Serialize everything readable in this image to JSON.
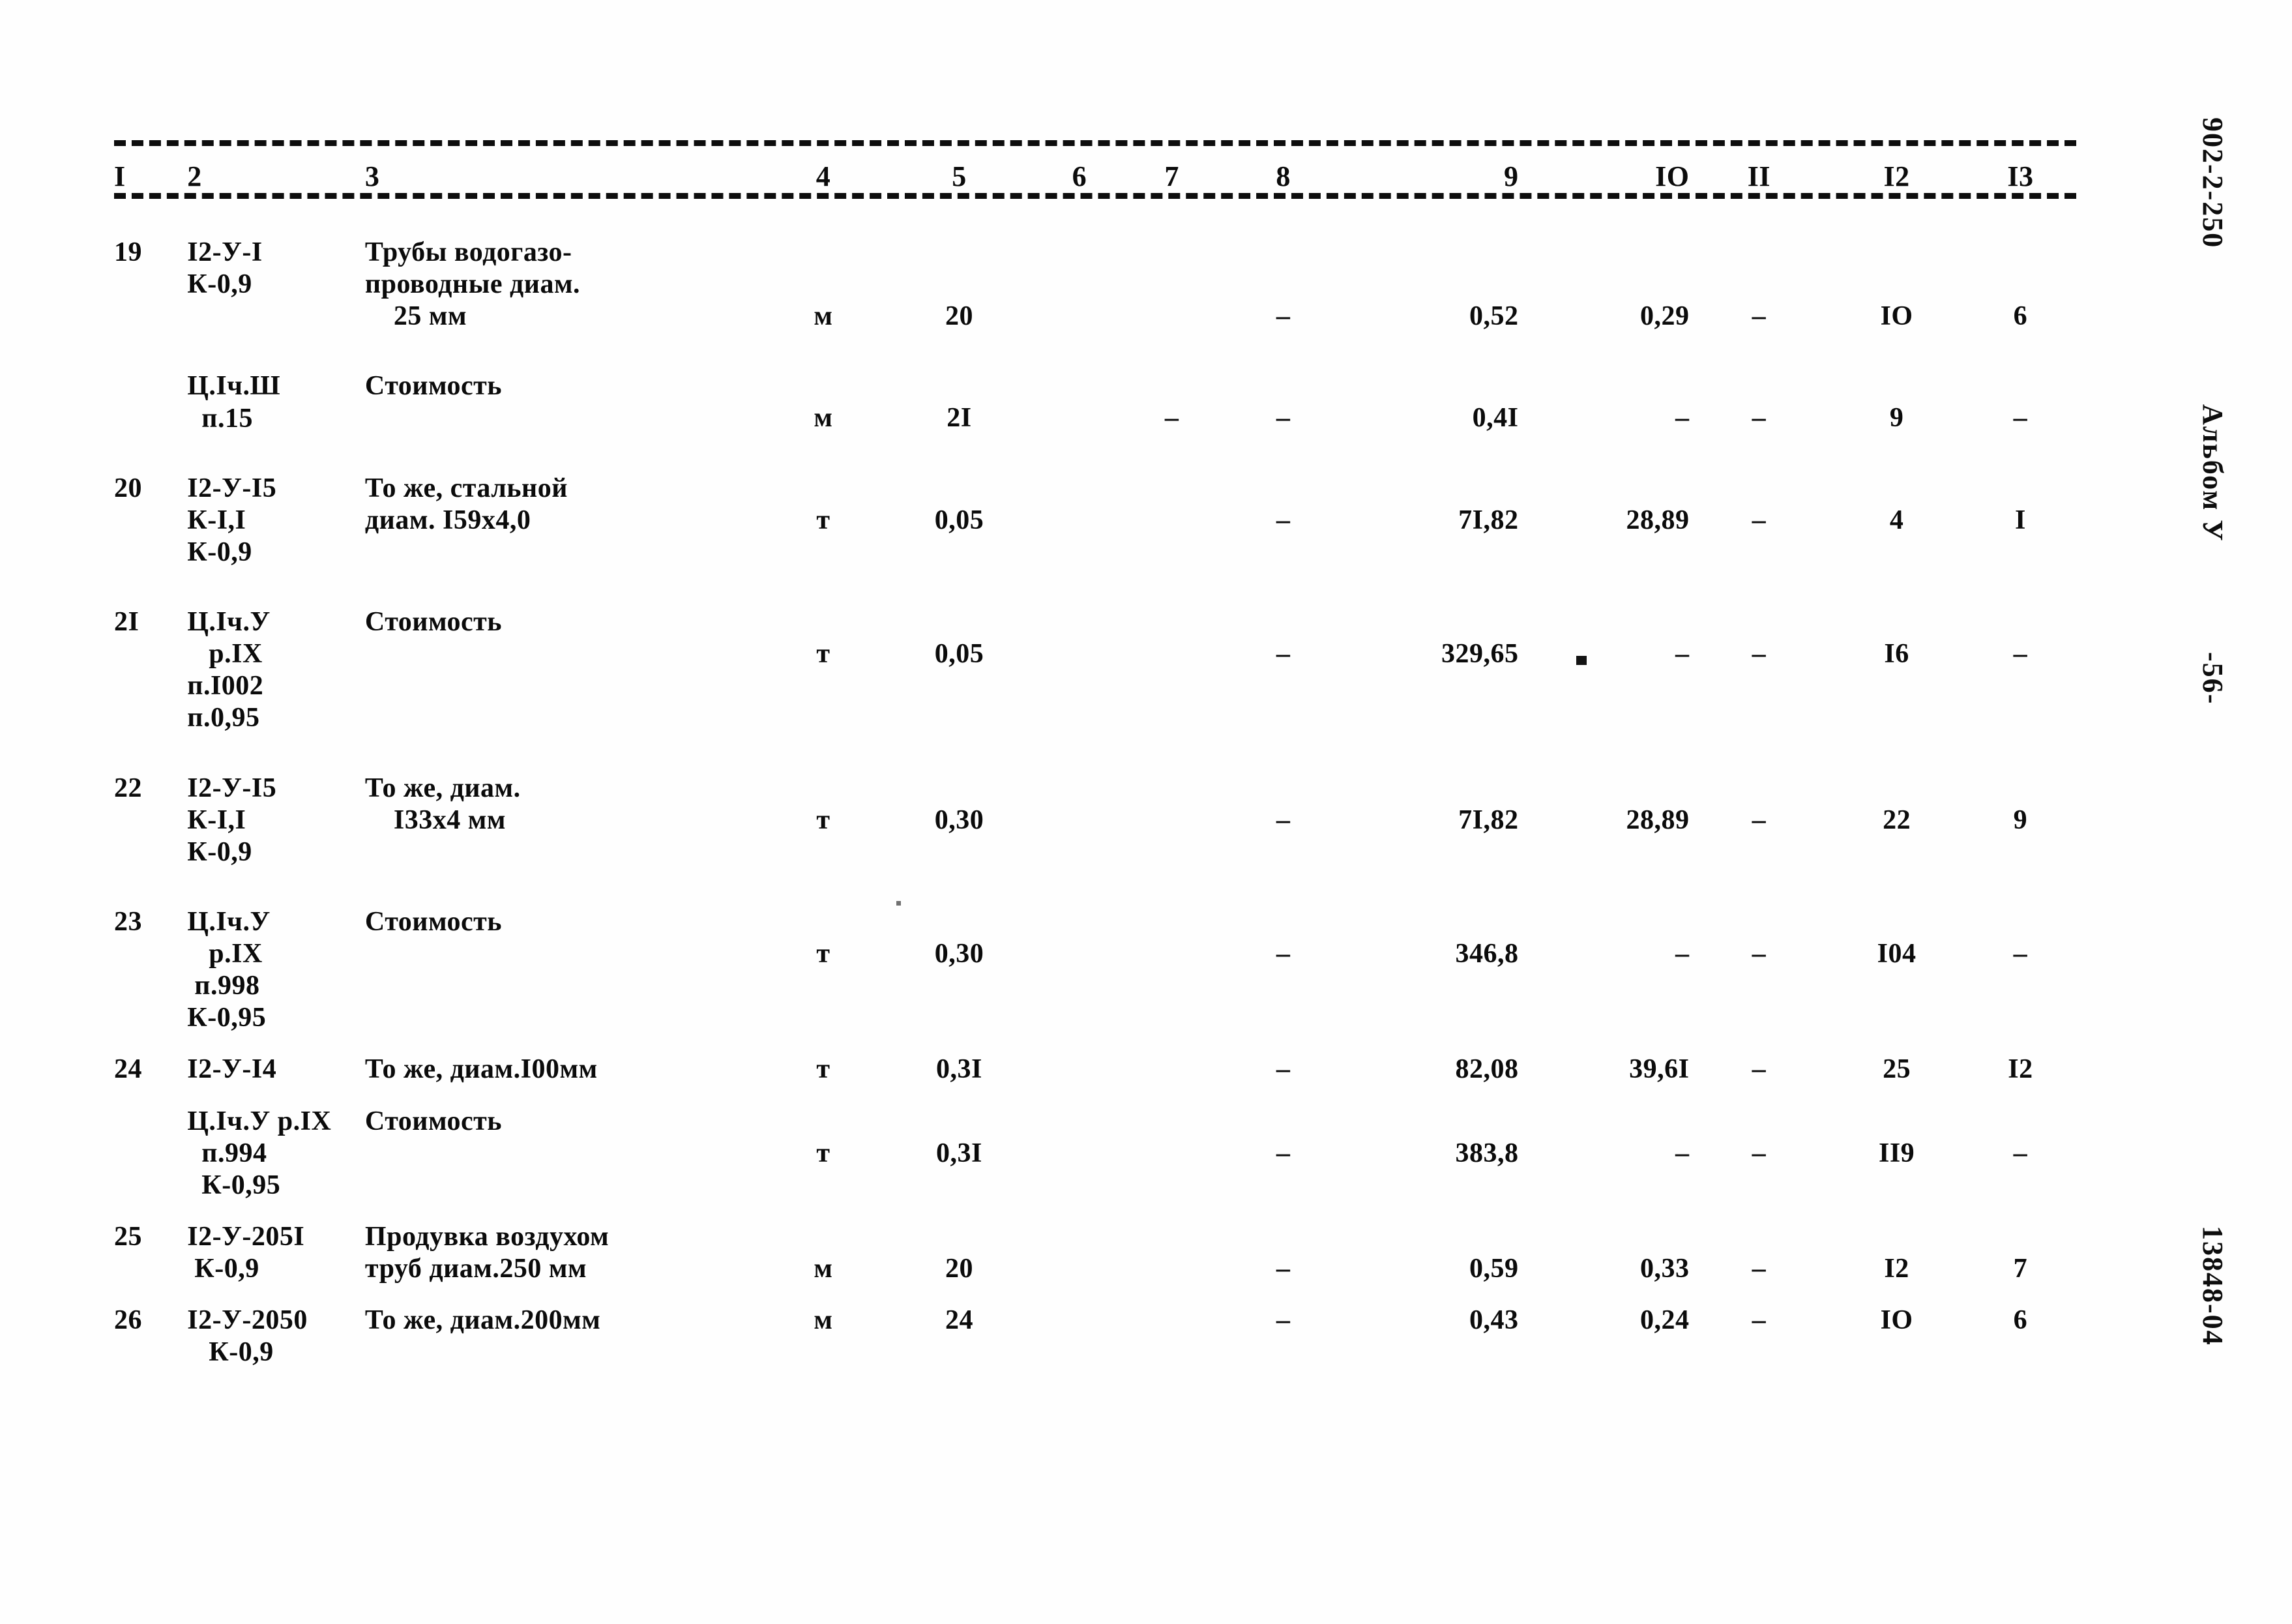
{
  "document": {
    "sheet_code": "902-2-250",
    "album": "Альбом У",
    "page_number": "-56-",
    "doc_number": "13848-04"
  },
  "table": {
    "column_headers": [
      "I",
      "2",
      "3",
      "4",
      "5",
      "6",
      "7",
      "8",
      "9",
      "IO",
      "II",
      "I2",
      "I3"
    ],
    "rows": [
      {
        "no": "19",
        "code": "I2-У-I\nК-0,9",
        "description": "Трубы водогазо-\nпроводные диам.\n    25 мм",
        "unit": "м",
        "qty": "20",
        "c6": "",
        "c7": "",
        "c8": "–",
        "c9": "0,52",
        "c10": "0,29",
        "c11": "–",
        "c12": "IO",
        "c13": "6",
        "num_line": 2
      },
      {
        "no": "",
        "code": "Ц.Iч.Ш\n  п.15",
        "description": "Стоимость",
        "unit": "м",
        "qty": "2I",
        "c6": "",
        "c7": "–",
        "c8": "–",
        "c9": "0,4I",
        "c10": "–",
        "c11": "–",
        "c12": "9",
        "c13": "–",
        "num_line": 1
      },
      {
        "no": "20",
        "code": "I2-У-I5\nК-I,I\nК-0,9",
        "description": "То же, стальной\nдиам. I59х4,0",
        "unit": "т",
        "qty": "0,05",
        "c6": "",
        "c7": "",
        "c8": "–",
        "c9": "7I,82",
        "c10": "28,89",
        "c11": "–",
        "c12": "4",
        "c13": "I",
        "num_line": 1
      },
      {
        "no": "2I",
        "code": "Ц.Iч.У\n   р.IX\nп.I002\nп.0,95",
        "description": "Стоимость",
        "unit": "т",
        "qty": "0,05",
        "c6": "",
        "c7": "",
        "c8": "–",
        "c9": "329,65",
        "c10": "–",
        "c11": "–",
        "c12": "I6",
        "c13": "–",
        "num_line": 1
      },
      {
        "no": "22",
        "code": "I2-У-I5\nК-I,I\nК-0,9",
        "description": "То же, диам.\n    I33х4 мм",
        "unit": "т",
        "qty": "0,30",
        "c6": "",
        "c7": "",
        "c8": "–",
        "c9": "7I,82",
        "c10": "28,89",
        "c11": "–",
        "c12": "22",
        "c13": "9",
        "num_line": 1
      },
      {
        "no": "23",
        "code": "Ц.Iч.У\n   р.IX\n п.998\nК-0,95",
        "description": "Стоимость",
        "unit": "т",
        "qty": "0,30",
        "c6": "",
        "c7": "",
        "c8": "–",
        "c9": "346,8",
        "c10": "–",
        "c11": "–",
        "c12": "I04",
        "c13": "–",
        "num_line": 1
      },
      {
        "no": "24",
        "code": "I2-У-I4",
        "description": "То же, диам.I00мм",
        "unit": "т",
        "qty": "0,3I",
        "c6": "",
        "c7": "",
        "c8": "–",
        "c9": "82,08",
        "c10": "39,6I",
        "c11": "–",
        "c12": "25",
        "c13": "I2",
        "num_line": 0
      },
      {
        "no": "",
        "code": "Ц.Iч.У р.IX\n  п.994\n  К-0,95",
        "description": "Стоимость",
        "unit": "т",
        "qty": "0,3I",
        "c6": "",
        "c7": "",
        "c8": "–",
        "c9": "383,8",
        "c10": "–",
        "c11": "–",
        "c12": "II9",
        "c13": "–",
        "num_line": 1
      },
      {
        "no": "25",
        "code": "I2-У-205I\n К-0,9",
        "description": "Продувка воздухом\nтруб диам.250 мм",
        "unit": "м",
        "qty": "20",
        "c6": "",
        "c7": "",
        "c8": "–",
        "c9": "0,59",
        "c10": "0,33",
        "c11": "–",
        "c12": "I2",
        "c13": "7",
        "num_line": 1
      },
      {
        "no": "26",
        "code": "I2-У-2050\n   К-0,9",
        "description": "То же, диам.200мм",
        "unit": "м",
        "qty": "24",
        "c6": "",
        "c7": "",
        "c8": "–",
        "c9": "0,43",
        "c10": "0,24",
        "c11": "–",
        "c12": "IO",
        "c13": "6",
        "num_line": 0
      }
    ]
  }
}
